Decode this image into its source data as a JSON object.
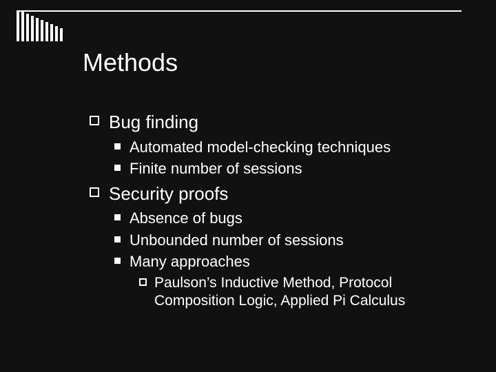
{
  "title": "Methods",
  "bullets": {
    "l1_0": "Bug finding",
    "l2_0": "Automated model-checking techniques",
    "l2_1": "Finite number of sessions",
    "l1_1": "Security proofs",
    "l2_2": "Absence of bugs",
    "l2_3": "Unbounded number of sessions",
    "l2_4": "Many approaches",
    "l3_0": "Paulson’s Inductive Method, Protocol Composition Logic, Applied Pi Calculus"
  }
}
